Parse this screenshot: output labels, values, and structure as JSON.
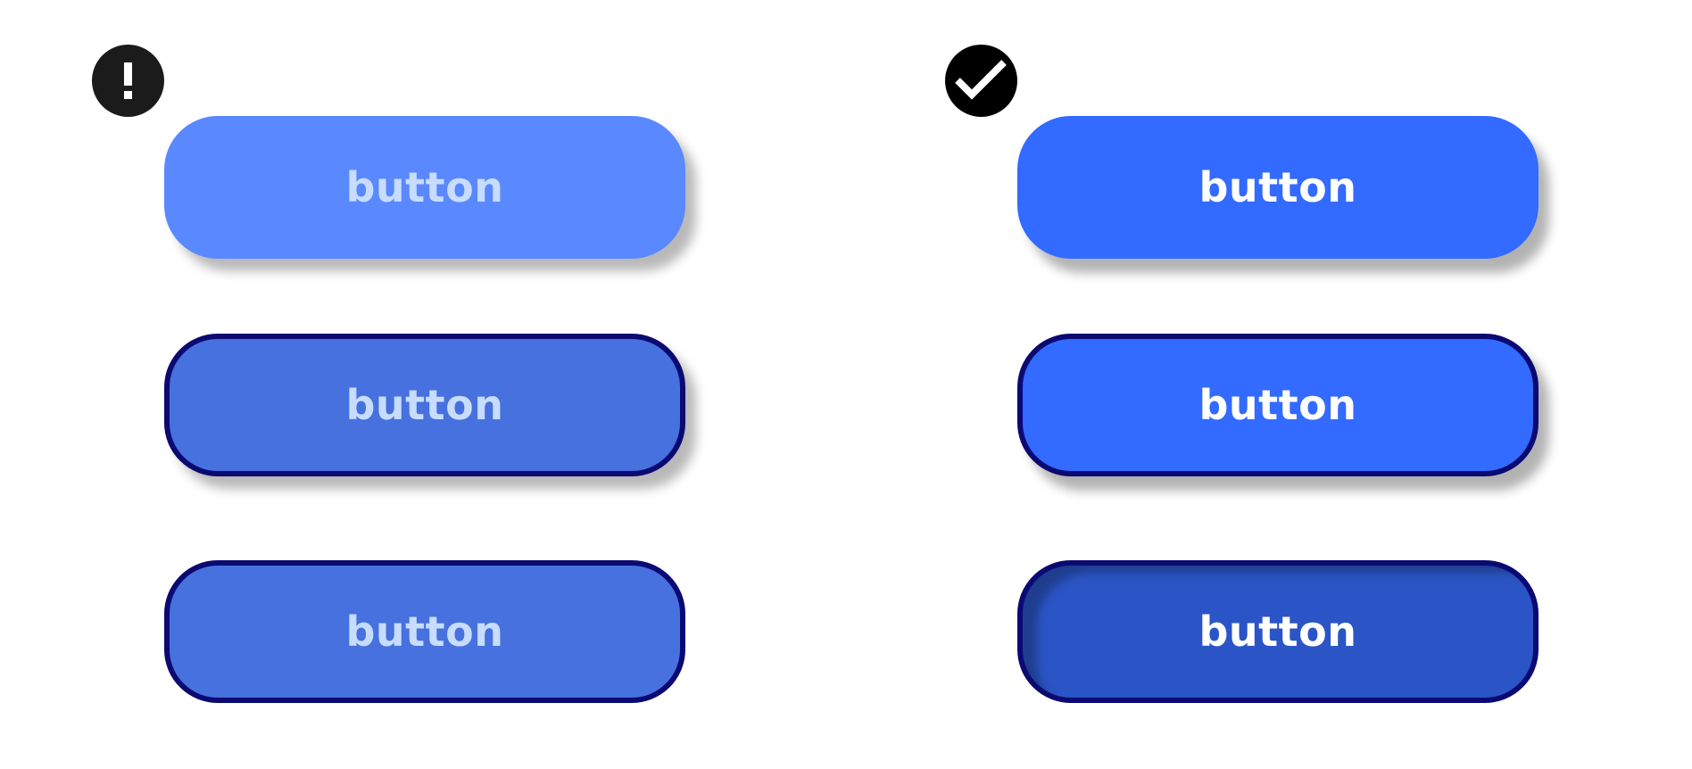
{
  "badges": {
    "warning_icon": "exclamation-icon",
    "ok_icon": "checkmark-icon"
  },
  "left_column": {
    "buttons": [
      {
        "label": "button",
        "state": "default"
      },
      {
        "label": "button",
        "state": "hover"
      },
      {
        "label": "button",
        "state": "pressed"
      }
    ]
  },
  "right_column": {
    "buttons": [
      {
        "label": "button",
        "state": "default"
      },
      {
        "label": "button",
        "state": "hover"
      },
      {
        "label": "button",
        "state": "pressed"
      }
    ]
  },
  "colors": {
    "bad_default_fill": "#5a88fe",
    "bad_state_fill": "#4671de",
    "bad_label": "#c7dcff",
    "good_fill": "#336aff",
    "good_pressed_fill": "#2b55c6",
    "good_label": "#ffffff",
    "outline": "#0b0a72"
  }
}
